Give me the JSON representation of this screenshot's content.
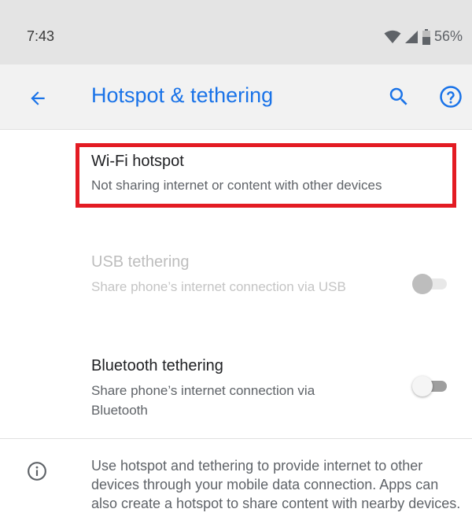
{
  "status_bar": {
    "time": "7:43",
    "battery": "56%",
    "icons": [
      "wifi-icon",
      "cell-signal-icon",
      "battery-icon"
    ]
  },
  "app_bar": {
    "title": "Hotspot & tethering",
    "icons": [
      "back-arrow-icon",
      "search-icon",
      "help-icon"
    ],
    "accent_color": "#1a73e8"
  },
  "items": [
    {
      "title": "Wi-Fi hotspot",
      "subtitle": "Not sharing internet or content with other devices",
      "highlighted": true,
      "highlight_color": "#e31b23"
    },
    {
      "title": "USB tethering",
      "subtitle": "Share phone’s internet connection via USB",
      "enabled": false,
      "toggle": "off"
    },
    {
      "title": "Bluetooth tethering",
      "subtitle": "Share phone’s internet connection via Bluetooth",
      "enabled": true,
      "toggle": "off"
    }
  ],
  "info": {
    "icon": "info-icon",
    "text": "Use hotspot and tethering to provide internet to other devices through your mobile data connection. Apps can also create a hotspot to share content with nearby devices."
  }
}
